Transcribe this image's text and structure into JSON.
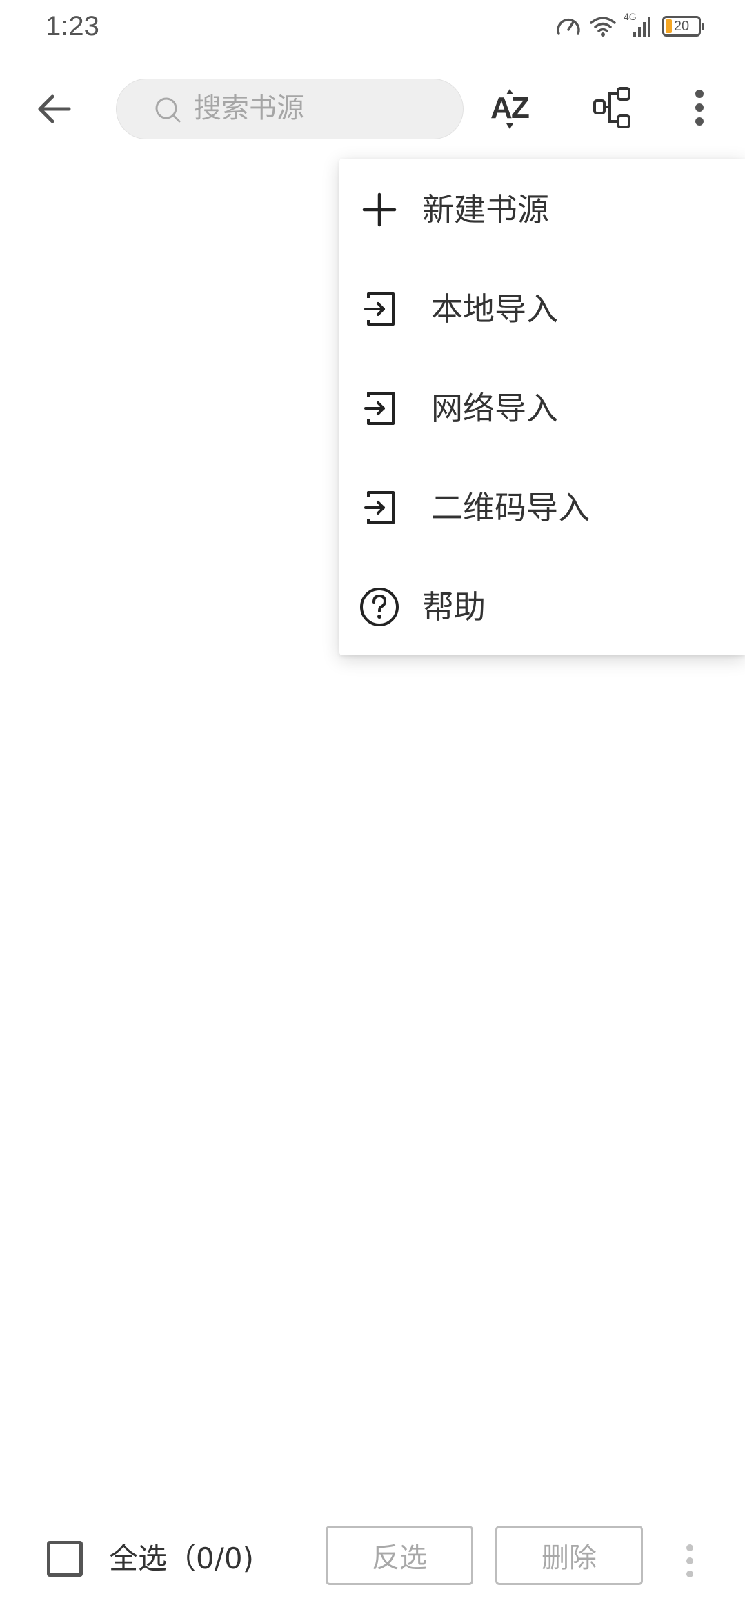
{
  "status_bar": {
    "time": "1:23",
    "network_type": "4G",
    "battery_level": "20",
    "icons": [
      "speed-meter-icon",
      "wifi-icon",
      "signal-icon",
      "battery-icon"
    ]
  },
  "toolbar": {
    "back_icon": "arrow-left-icon",
    "search": {
      "placeholder": "搜索书源",
      "value": ""
    },
    "sort_icon": "sort-az-icon",
    "group_icon": "group-icon",
    "more_icon": "more-vertical-icon"
  },
  "menu": {
    "items": [
      {
        "label": "新建书源",
        "icon": "plus-icon"
      },
      {
        "label": "本地导入",
        "icon": "import-icon"
      },
      {
        "label": "网络导入",
        "icon": "import-icon"
      },
      {
        "label": "二维码导入",
        "icon": "import-icon"
      },
      {
        "label": "帮助",
        "icon": "help-circle-icon"
      }
    ]
  },
  "bottom_bar": {
    "select_all_label": "全选（0/0)",
    "select_all_checked": false,
    "invert_label": "反选",
    "delete_label": "删除",
    "more_icon": "more-vertical-icon"
  },
  "colors": {
    "battery_fill": "#f5a623",
    "search_bg": "#efefef",
    "disabled_text": "#a8a8a8",
    "button_border": "#bdbdbd"
  }
}
